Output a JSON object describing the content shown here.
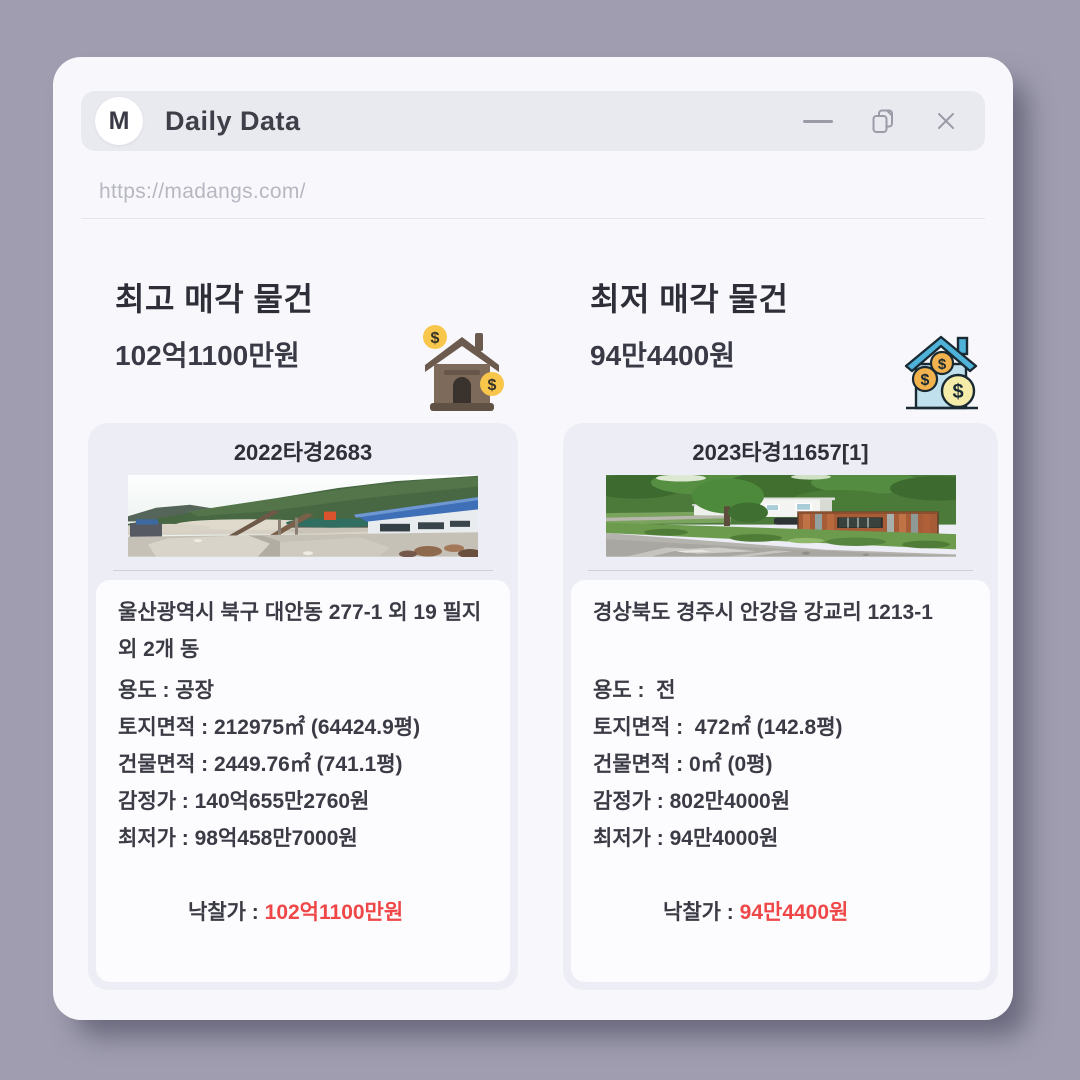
{
  "window": {
    "logo_letter": "M",
    "title": "Daily Data",
    "url": "https://madangs.com/"
  },
  "colors": {
    "background": "#9f9daf",
    "window": "#f8f8fc",
    "titlebar": "#e9e9f0",
    "card": "#ededf6",
    "details_panel": "#fcfcff",
    "accent_red": "#ef4747",
    "text_dark": "#2e2e38",
    "muted_gray": "#b7b7c2"
  },
  "sections": [
    {
      "heading": "최고 매각 물건",
      "amount": "102억1100만원",
      "icon": "brown-house-with-dollar-coins",
      "card": {
        "case_no": "2022타경2683",
        "photo": "industrial-quarry-site-photo",
        "address": "울산광역시 북구 대안동 277-1 외 19 필지 외 2개 동",
        "rows": [
          "용도 : 공장",
          "토지면적 : 212975㎡ (64424.9평)",
          "건물면적 : 2449.76㎡ (741.1평)",
          "감정가 : 140억655만2760원",
          "최저가 : 98억458만7000원"
        ],
        "final_label": "낙찰가 : ",
        "final_value": "102억1100만원"
      }
    },
    {
      "heading": "최저 매각 물건",
      "amount": "94만4400원",
      "icon": "blue-house-with-dollar-coins",
      "card": {
        "case_no": "2023타경11657[1]",
        "photo": "rural-lot-with-rusty-container-photo",
        "address": "경상북도 경주시 안강읍 강교리 1213-1",
        "rows": [
          "용도 :  전",
          "토지면적 :  472㎡ (142.8평)",
          "건물면적 : 0㎡ (0평)",
          "감정가 : 802만4000원",
          "최저가 : 94만4000원"
        ],
        "final_label": "낙찰가 : ",
        "final_value": "94만4400원"
      }
    }
  ]
}
